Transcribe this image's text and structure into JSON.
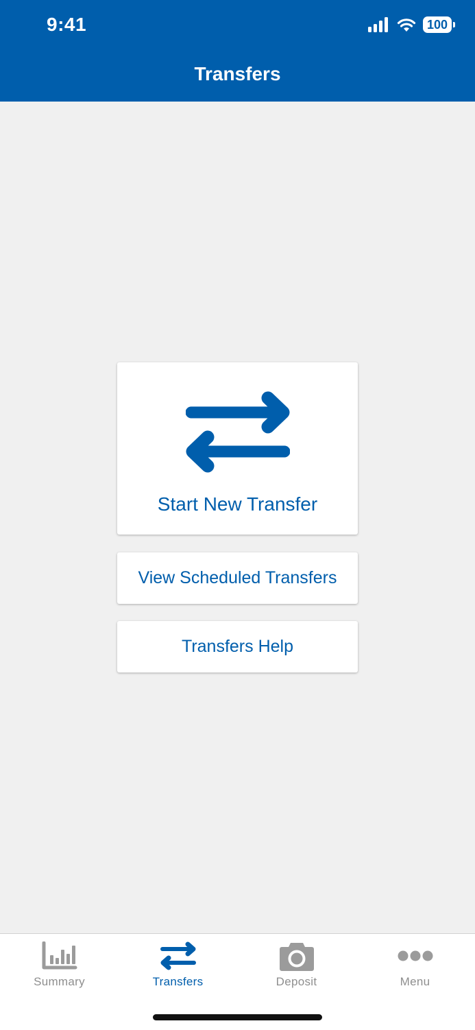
{
  "status_bar": {
    "time": "9:41",
    "battery": "100"
  },
  "header": {
    "title": "Transfers"
  },
  "actions": {
    "start_transfer": "Start New Transfer",
    "view_scheduled": "View Scheduled Transfers",
    "help": "Transfers Help"
  },
  "tabs": [
    {
      "label": "Summary",
      "icon": "bar-chart-icon",
      "active": false
    },
    {
      "label": "Transfers",
      "icon": "transfer-arrows-icon",
      "active": true
    },
    {
      "label": "Deposit",
      "icon": "camera-icon",
      "active": false
    },
    {
      "label": "Menu",
      "icon": "more-dots-icon",
      "active": false
    }
  ],
  "colors": {
    "brand": "#005eac",
    "background": "#f0f0f0",
    "inactive_tab": "#8e8e8e"
  }
}
